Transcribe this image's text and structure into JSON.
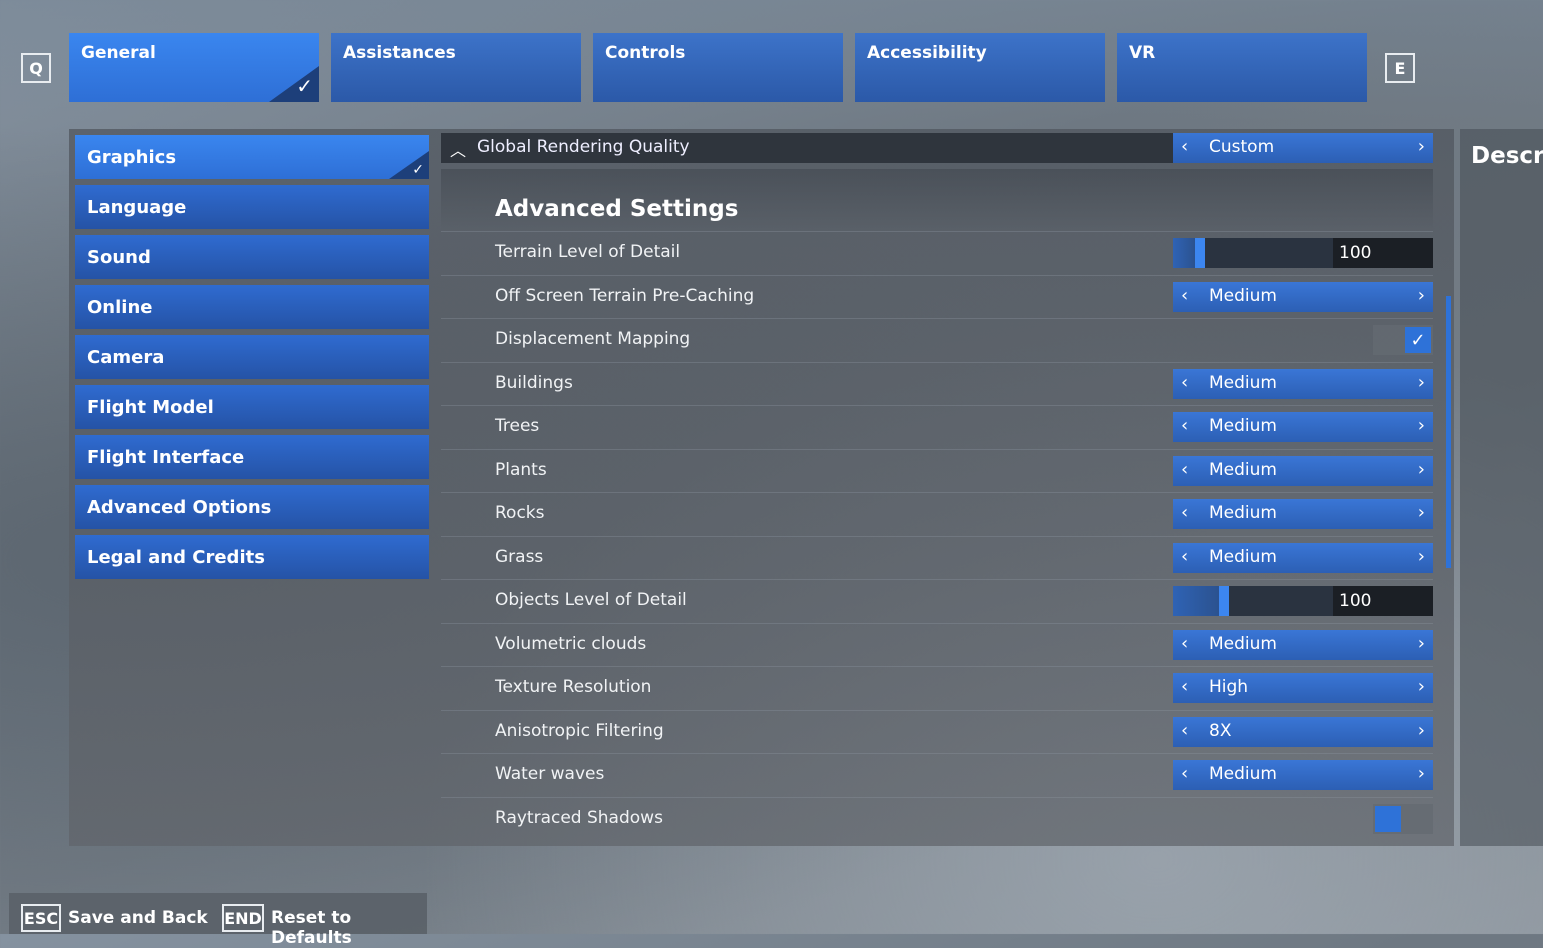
{
  "nav_keys": {
    "prev": "Q",
    "next": "E"
  },
  "tabs": [
    {
      "label": "General",
      "active": true
    },
    {
      "label": "Assistances"
    },
    {
      "label": "Controls"
    },
    {
      "label": "Accessibility"
    },
    {
      "label": "VR"
    }
  ],
  "sidebar": {
    "items": [
      {
        "label": "Graphics",
        "active": true
      },
      {
        "label": "Language"
      },
      {
        "label": "Sound"
      },
      {
        "label": "Online"
      },
      {
        "label": "Camera"
      },
      {
        "label": "Flight Model"
      },
      {
        "label": "Flight Interface"
      },
      {
        "label": "Advanced Options"
      },
      {
        "label": "Legal and Credits"
      }
    ]
  },
  "global_quality": {
    "label": "Global Rendering Quality",
    "value": "Custom"
  },
  "section_title": "Advanced Settings",
  "settings": [
    {
      "label": "Terrain Level of Detail",
      "type": "slider",
      "value": "100",
      "level": 0.14
    },
    {
      "label": "Off Screen Terrain Pre-Caching",
      "type": "selector",
      "value": "Medium"
    },
    {
      "label": "Displacement Mapping",
      "type": "toggle",
      "on": true
    },
    {
      "label": "Buildings",
      "type": "selector",
      "value": "Medium"
    },
    {
      "label": "Trees",
      "type": "selector",
      "value": "Medium"
    },
    {
      "label": "Plants",
      "type": "selector",
      "value": "Medium"
    },
    {
      "label": "Rocks",
      "type": "selector",
      "value": "Medium"
    },
    {
      "label": "Grass",
      "type": "selector",
      "value": "Medium"
    },
    {
      "label": "Objects Level of Detail",
      "type": "slider",
      "value": "100",
      "level": 0.29
    },
    {
      "label": "Volumetric clouds",
      "type": "selector",
      "value": "Medium"
    },
    {
      "label": "Texture Resolution",
      "type": "selector",
      "value": "High"
    },
    {
      "label": "Anisotropic Filtering",
      "type": "selector",
      "value": "8X"
    },
    {
      "label": "Water waves",
      "type": "selector",
      "value": "Medium"
    },
    {
      "label": "Raytraced Shadows",
      "type": "toggle",
      "on": false
    }
  ],
  "description_title": "Descri",
  "footer": {
    "save": {
      "key": "ESC",
      "label": "Save and Back"
    },
    "reset": {
      "key": "END",
      "label": "Reset to Defaults"
    }
  },
  "colors": {
    "accent": "#2e72d8",
    "tab": "#2b59a8",
    "active": "#3a86ef"
  }
}
